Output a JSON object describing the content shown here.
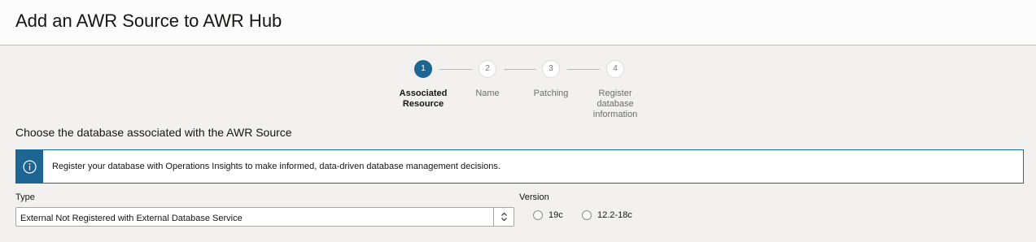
{
  "header": {
    "title": "Add an AWR Source to AWR Hub"
  },
  "train": {
    "steps": [
      {
        "number": "1",
        "label": "Associated Resource",
        "state": "active"
      },
      {
        "number": "2",
        "label": "Name",
        "state": "pending"
      },
      {
        "number": "3",
        "label": "Patching",
        "state": "pending"
      },
      {
        "number": "4",
        "label": "Register database information",
        "state": "pending"
      }
    ]
  },
  "section": {
    "title": "Choose the database associated with the AWR Source"
  },
  "info": {
    "icon": "info-icon",
    "message": "Register your database with Operations Insights to make informed, data-driven database management decisions."
  },
  "form": {
    "type_label": "Type",
    "type_value": "External Not Registered with External Database Service",
    "version_label": "Version",
    "version_options": [
      "19c",
      "12.2-18c"
    ]
  },
  "colors": {
    "accent": "#1d6593",
    "background": "#f2f1f0",
    "header_background": "#fcfcfc"
  }
}
